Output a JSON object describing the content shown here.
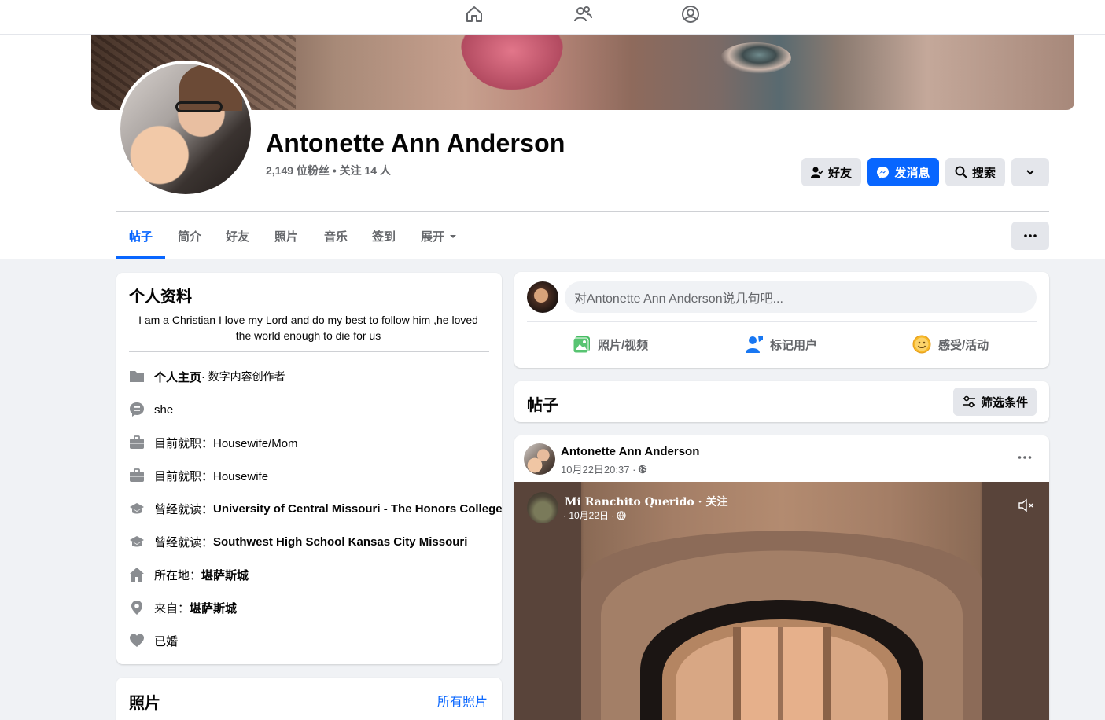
{
  "topnav": {
    "icons": [
      "home-icon",
      "friends-icon",
      "profile-icon"
    ]
  },
  "profile": {
    "name": "Antonette Ann Anderson",
    "stats": "2,149 位粉丝 • 关注 14 人"
  },
  "actions": {
    "friends": "好友",
    "message": "发消息",
    "search": "搜索"
  },
  "tabs": [
    {
      "label": "帖子",
      "active": true
    },
    {
      "label": "简介"
    },
    {
      "label": "好友"
    },
    {
      "label": "照片"
    },
    {
      "label": "音乐"
    },
    {
      "label": "签到"
    },
    {
      "label": "展开"
    }
  ],
  "intro": {
    "title": "个人资料",
    "bio": "I am a Christian I love my Lord and do my best to follow him ,he loved the world enough to die for us",
    "rows": [
      {
        "icon": "page-icon",
        "label": "个人主页",
        "rest": " · 数字内容创作者"
      },
      {
        "icon": "pronoun-icon",
        "label": "",
        "rest": "she"
      },
      {
        "icon": "work-icon",
        "label": "",
        "rest": "目前就职：Housewife/Mom"
      },
      {
        "icon": "work-icon",
        "label": "",
        "rest": "目前就职：Housewife"
      },
      {
        "icon": "education-icon",
        "label": "",
        "pre": "曾经就读：",
        "value": "University of Central Missouri - The Honors College"
      },
      {
        "icon": "education-icon",
        "label": "",
        "pre": "曾经就读：",
        "value": "Southwest High School Kansas City Missouri"
      },
      {
        "icon": "home-location-icon",
        "label": "",
        "pre": "所在地：",
        "value": "堪萨斯城"
      },
      {
        "icon": "pin-icon",
        "label": "",
        "pre": "来自：",
        "value": "堪萨斯城"
      },
      {
        "icon": "heart-icon",
        "label": "",
        "rest": "已婚"
      }
    ]
  },
  "photos": {
    "title": "照片",
    "link": "所有照片"
  },
  "composer": {
    "placeholder": "对Antonette Ann Anderson说几句吧...",
    "actions": [
      "照片/视频",
      "标记用户",
      "感受/活动"
    ],
    "colors": {
      "photo": "#45bd62",
      "tag": "#1877f2",
      "feeling": "#f7b928"
    }
  },
  "posts_header": {
    "title": "帖子",
    "filter": "筛选条件"
  },
  "post": {
    "author": "Antonette Ann Anderson",
    "time": "10月22日20:37 ·",
    "shared_page": "Mi Ranchito Querido · 关注",
    "shared_time": "· 10月22日 ·"
  }
}
